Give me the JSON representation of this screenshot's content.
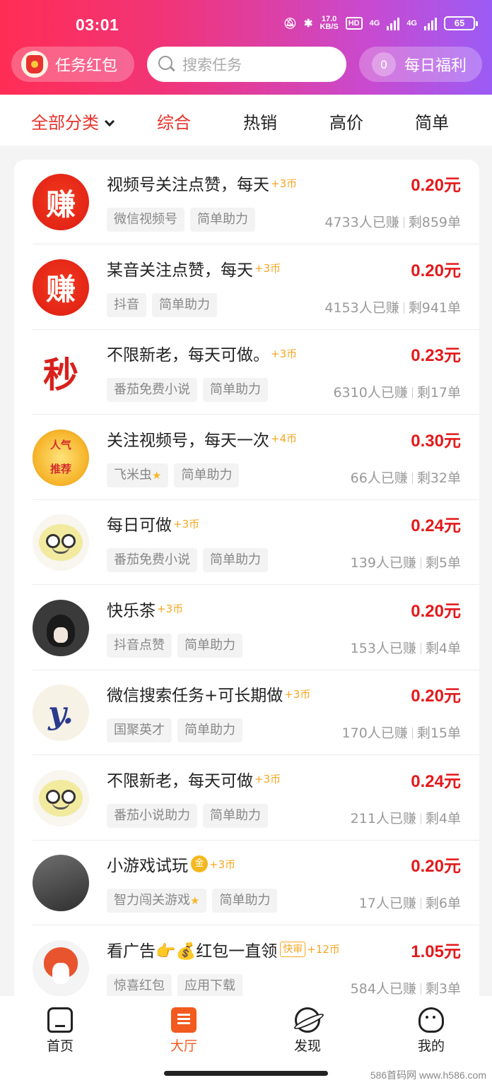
{
  "status_bar": {
    "time": "03:01",
    "net_speed_top": "17.0",
    "net_speed_bottom": "KB/S",
    "hd_label": "HD",
    "net1": "4G",
    "net2": "4G",
    "battery": "65"
  },
  "header": {
    "left_button": "任务红包",
    "search_placeholder": "搜索任务",
    "right_badge": "0",
    "right_button": "每日福利"
  },
  "tabs": {
    "all_categories": "全部分类",
    "items": [
      "综合",
      "热销",
      "高价",
      "简单"
    ],
    "active_index": 0
  },
  "tasks": [
    {
      "title": "视频号关注点赞，每天",
      "coin": "+3币",
      "price": "0.20元",
      "tags": [
        "微信视频号",
        "简单助力"
      ],
      "earned": "4733人已赚",
      "remaining": "剩859单",
      "avatar": "zhuan",
      "avatar_text": "赚"
    },
    {
      "title": "某音关注点赞，每天",
      "coin": "+3币",
      "price": "0.20元",
      "tags": [
        "抖音",
        "简单助力"
      ],
      "earned": "4153人已赚",
      "remaining": "剩941单",
      "avatar": "zhuan",
      "avatar_text": "赚"
    },
    {
      "title": "不限新老，每天可做。",
      "coin": "+3币",
      "price": "0.23元",
      "tags": [
        "番茄免费小说",
        "简单助力"
      ],
      "earned": "6310人已赚",
      "remaining": "剩17单",
      "avatar": "miao",
      "avatar_text": "秒"
    },
    {
      "title": "关注视频号，每天一次",
      "coin": "+4币",
      "price": "0.30元",
      "tags": [
        "飞米虫",
        "简单助力"
      ],
      "earned": "66人已赚",
      "remaining": "剩32单",
      "avatar": "renqi",
      "avatar_text": "人气推荐"
    },
    {
      "title": "每日可做",
      "coin": "+3币",
      "price": "0.24元",
      "tags": [
        "番茄免费小说",
        "简单助力"
      ],
      "earned": "139人已赚",
      "remaining": "剩5单",
      "avatar": "face",
      "avatar_text": ""
    },
    {
      "title": "快乐茶",
      "coin": "+3币",
      "price": "0.20元",
      "tags": [
        "抖音点赞",
        "简单助力"
      ],
      "earned": "153人已赚",
      "remaining": "剩4单",
      "avatar": "dark",
      "avatar_text": ""
    },
    {
      "title": "微信搜索任务+可长期做",
      "coin": "+3币",
      "price": "0.20元",
      "tags": [
        "国聚英才",
        "简单助力"
      ],
      "earned": "170人已赚",
      "remaining": "剩15单",
      "avatar": "y",
      "avatar_text": "y."
    },
    {
      "title": "不限新老，每天可做",
      "coin": "+3币",
      "price": "0.24元",
      "tags": [
        "番茄小说助力",
        "简单助力"
      ],
      "earned": "211人已赚",
      "remaining": "剩4单",
      "avatar": "face",
      "avatar_text": ""
    },
    {
      "title": "小游戏试玩",
      "badge": "金",
      "coin": "+3币",
      "price": "0.20元",
      "tags": [
        "智力闯关游戏",
        "简单助力"
      ],
      "earned": "17人已赚",
      "remaining": "剩6单",
      "avatar": "game",
      "avatar_text": ""
    },
    {
      "title": "看广告👉💰红包一直领",
      "badge_fast": "快审",
      "coin": "+12币",
      "price": "1.05元",
      "tags": [
        "惊喜红包",
        "应用下载"
      ],
      "earned": "584人已赚",
      "remaining": "剩3单",
      "avatar": "fox",
      "avatar_text": ""
    }
  ],
  "bottom_nav": {
    "items": [
      "首页",
      "大厅",
      "发现",
      "我的"
    ],
    "active_index": 1
  },
  "watermark": "586首码网 www.h586.com"
}
